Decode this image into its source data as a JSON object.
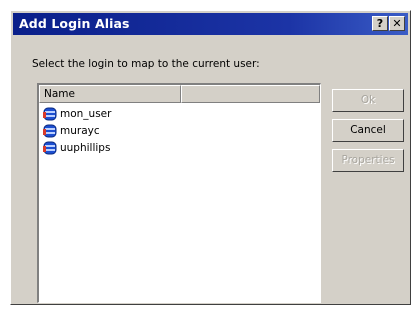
{
  "dialog": {
    "title": "Add Login Alias",
    "help_button": "?",
    "close_button": "✕",
    "instruction": "Select the login to map to the current user:",
    "list": {
      "columns": [
        "Name",
        ""
      ],
      "items": [
        "mon_user",
        "murayc",
        "uuphillips"
      ]
    },
    "buttons": {
      "ok": "Ok",
      "cancel": "Cancel",
      "properties": "Properties"
    }
  }
}
